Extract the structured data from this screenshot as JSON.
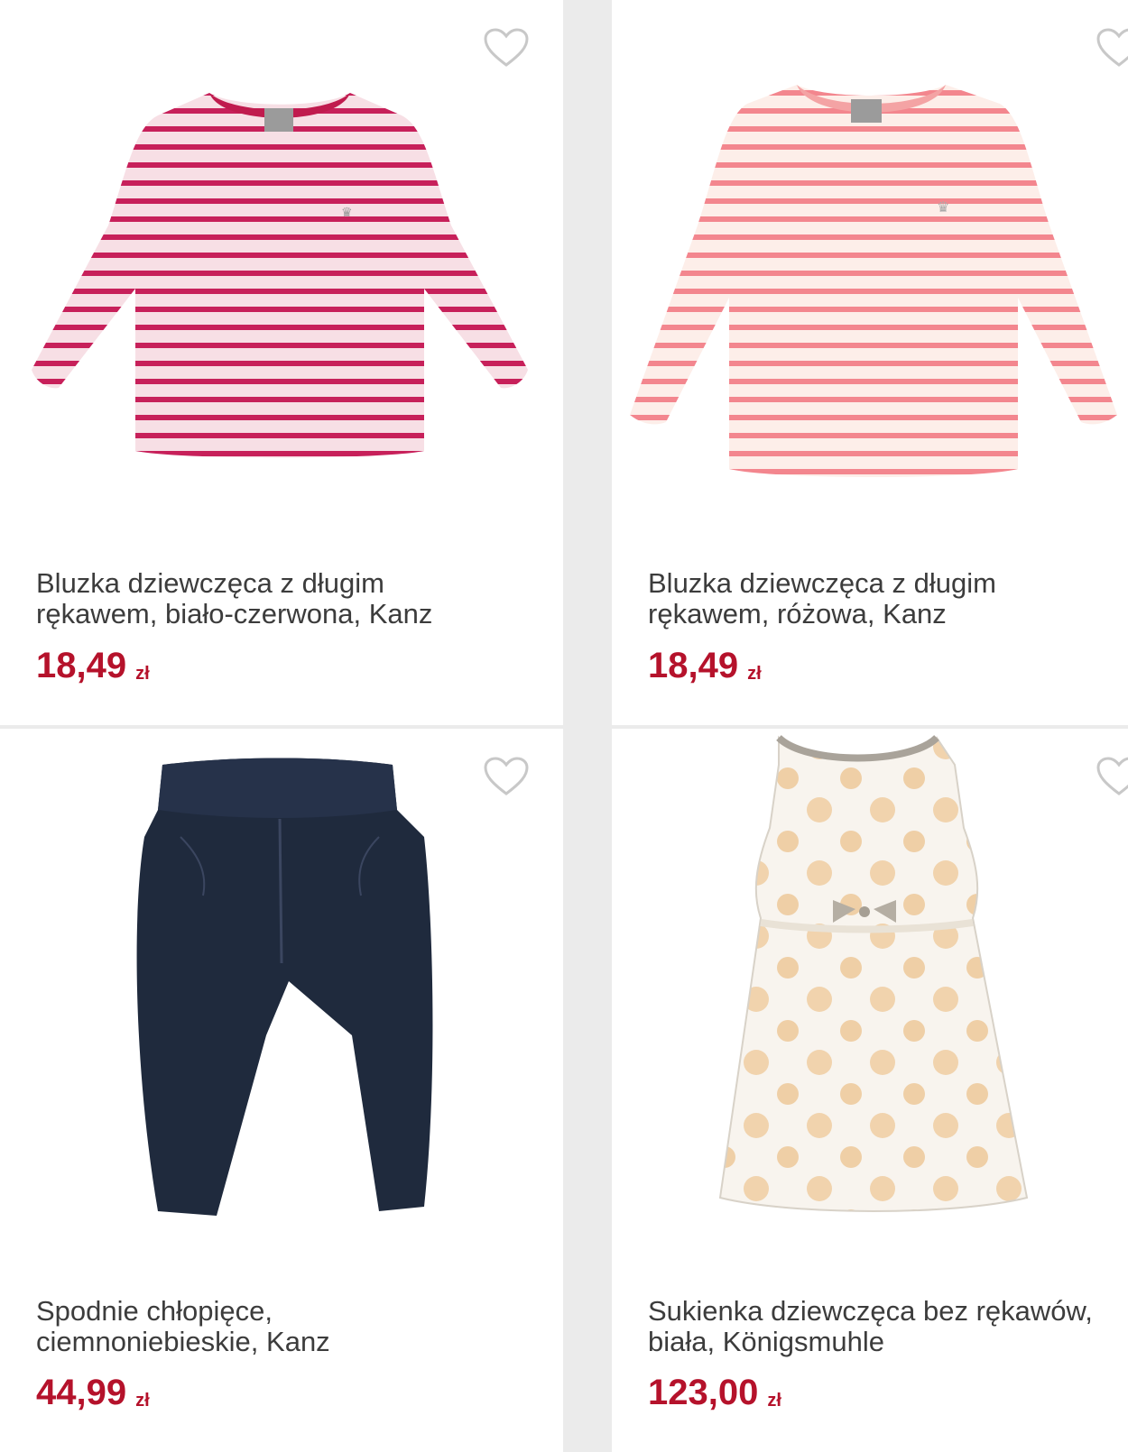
{
  "colors": {
    "price": "#b5122b",
    "title": "#3c3c3c",
    "background": "#ebebeb",
    "card": "#ffffff"
  },
  "products": [
    {
      "title_line1": "Bluzka dziewczęca z długim",
      "title_line2": "rękawem, biało-czerwona, Kanz",
      "price": "18,49",
      "currency": "zł",
      "icon": "heart-outline-icon",
      "image": "striped-top-red"
    },
    {
      "title_line1": "Bluzka dziewczęca z długim",
      "title_line2": "rękawem, różowa, Kanz",
      "price": "18,49",
      "currency": "zł",
      "icon": "heart-outline-icon",
      "image": "striped-top-pink"
    },
    {
      "title_line1": "Spodnie chłopięce,",
      "title_line2": "ciemnoniebieskie, Kanz",
      "price": "44,99",
      "currency": "zł",
      "icon": "heart-outline-icon",
      "image": "navy-trousers"
    },
    {
      "title_line1": "Sukienka dziewczęca bez rękawów,",
      "title_line2": "biała, Königsmuhle",
      "price": "123,00",
      "currency": "zł",
      "icon": "heart-outline-icon",
      "image": "floral-dress"
    }
  ]
}
